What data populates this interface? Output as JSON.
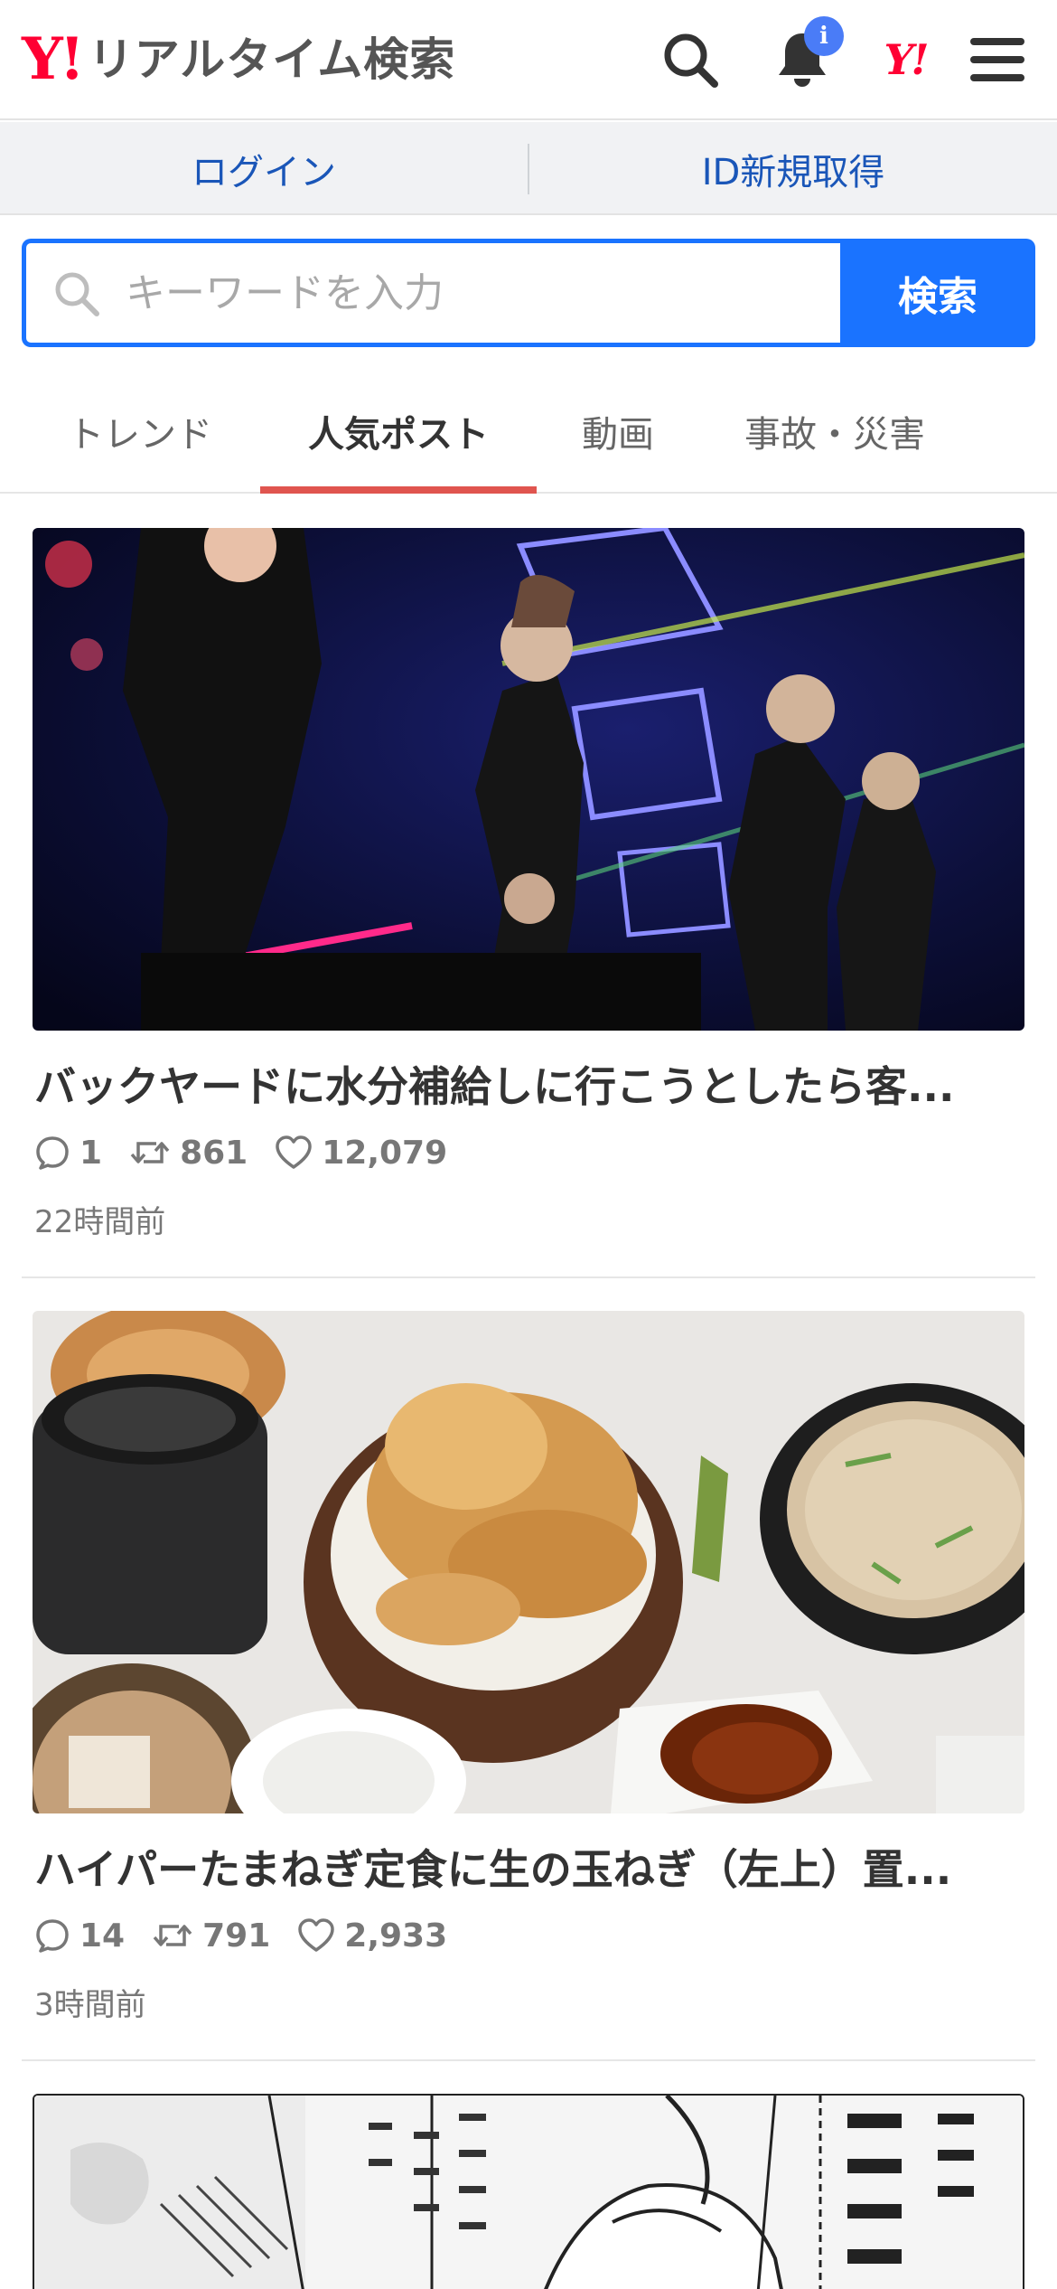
{
  "header": {
    "logo_mark": "Y!",
    "logo_text": "リアルタイム検索",
    "icons": [
      "search-icon",
      "bell-icon",
      "yahoo-icon",
      "menu-icon"
    ],
    "notification_badge": "i",
    "yahoo_mark": "Y!"
  },
  "login_bar": {
    "login_label": "ログイン",
    "register_label": "ID新規取得"
  },
  "search": {
    "placeholder": "キーワードを入力",
    "button_label": "検索"
  },
  "tabs": [
    {
      "label": "トレンド",
      "active": false
    },
    {
      "label": "人気ポスト",
      "active": true
    },
    {
      "label": "動画",
      "active": false
    },
    {
      "label": "事故・災害",
      "active": false
    }
  ],
  "posts": [
    {
      "title": "バックヤードに水分補給しに行こうとしたら客...",
      "replies": "1",
      "reposts": "861",
      "likes": "12,079",
      "time": "22時間前"
    },
    {
      "title": "ハイパーたまねぎ定食に生の玉ねぎ（左上）置...",
      "replies": "14",
      "reposts": "791",
      "likes": "2,933",
      "time": "3時間前"
    }
  ],
  "colors": {
    "brand_red": "#ff0033",
    "search_blue": "#1a73ff",
    "link_blue": "#1a56b8",
    "tab_underline": "#e0554f",
    "badge_blue": "#4a7cf7"
  }
}
